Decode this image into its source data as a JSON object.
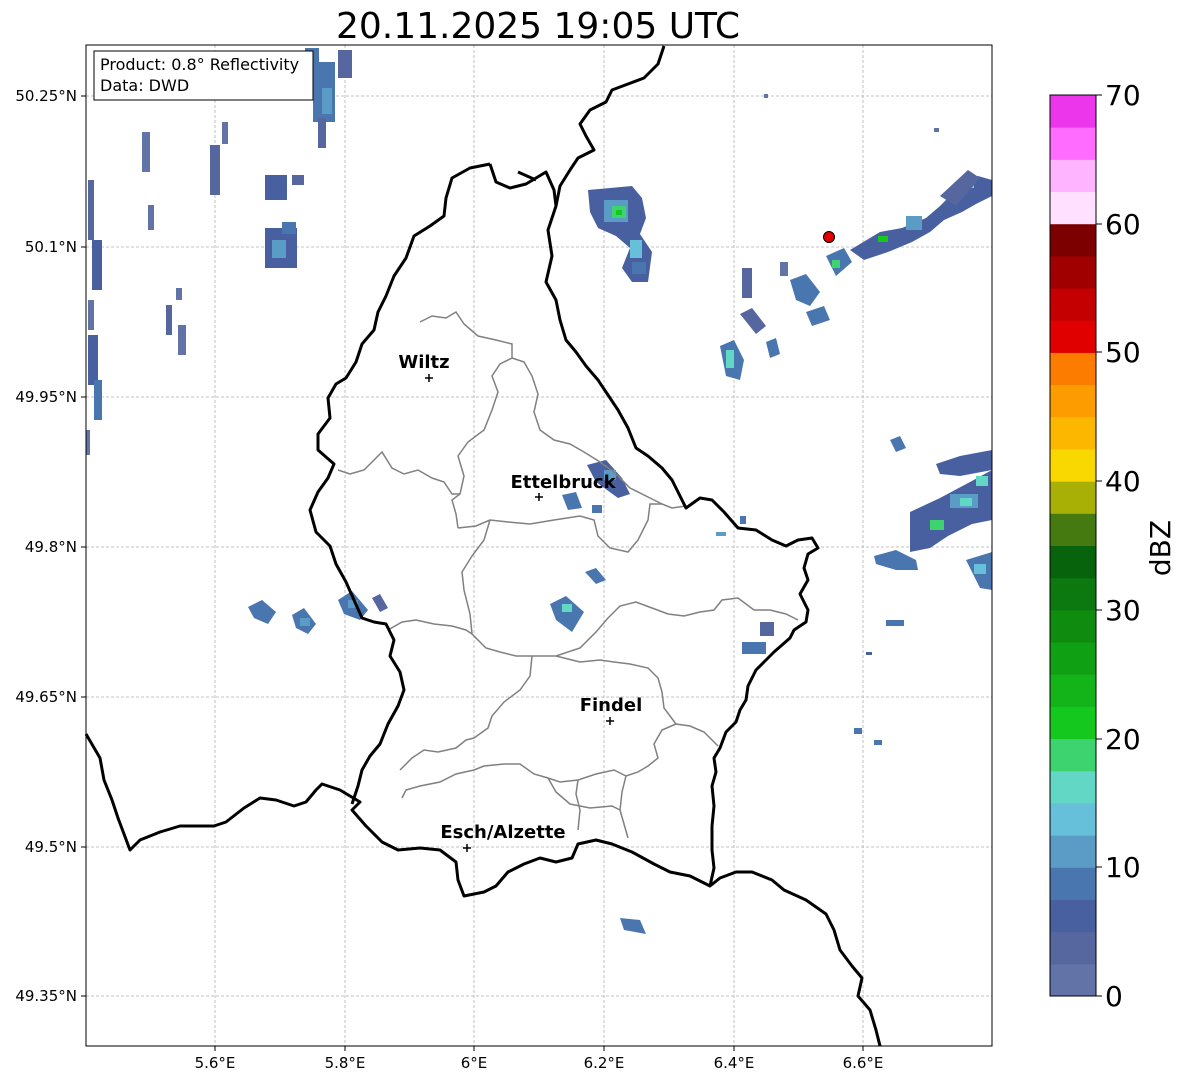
{
  "title": "20.11.2025 19:05 UTC",
  "info_box": {
    "product": "Product: 0.8° Reflectivity",
    "data": "Data: DWD"
  },
  "axes": {
    "lon_ticks": [
      "5.6°E",
      "5.8°E",
      "6°E",
      "6.2°E",
      "6.4°E",
      "6.6°E"
    ],
    "lat_ticks": [
      "50.25°N",
      "50.1°N",
      "49.95°N",
      "49.8°N",
      "49.65°N",
      "49.5°N",
      "49.35°N"
    ],
    "grid": true
  },
  "cities": [
    {
      "name": "Wiltz"
    },
    {
      "name": "Ettelbruck"
    },
    {
      "name": "Findel"
    },
    {
      "name": "Esch/Alzette"
    }
  ],
  "colorbar": {
    "label": "dBZ",
    "tick_labels": [
      "0",
      "10",
      "20",
      "30",
      "40",
      "50",
      "60",
      "70"
    ],
    "colors": [
      "#6273a8",
      "#56669e",
      "#4860a0",
      "#4a76b0",
      "#5b9cc6",
      "#66c0da",
      "#63d7c5",
      "#3dd470",
      "#14c81e",
      "#12b41a",
      "#10a013",
      "#0f8c10",
      "#0c7810",
      "#08640c",
      "#457a10",
      "#a8b005",
      "#f8d800",
      "#fcb800",
      "#fc9c00",
      "#fc7c00",
      "#e00000",
      "#c40000",
      "#a00000",
      "#7c0000",
      "#ffe0ff",
      "#ffb4ff",
      "#ff6cff",
      "#ec36ec"
    ]
  },
  "marker": {
    "color": "#e00000"
  }
}
